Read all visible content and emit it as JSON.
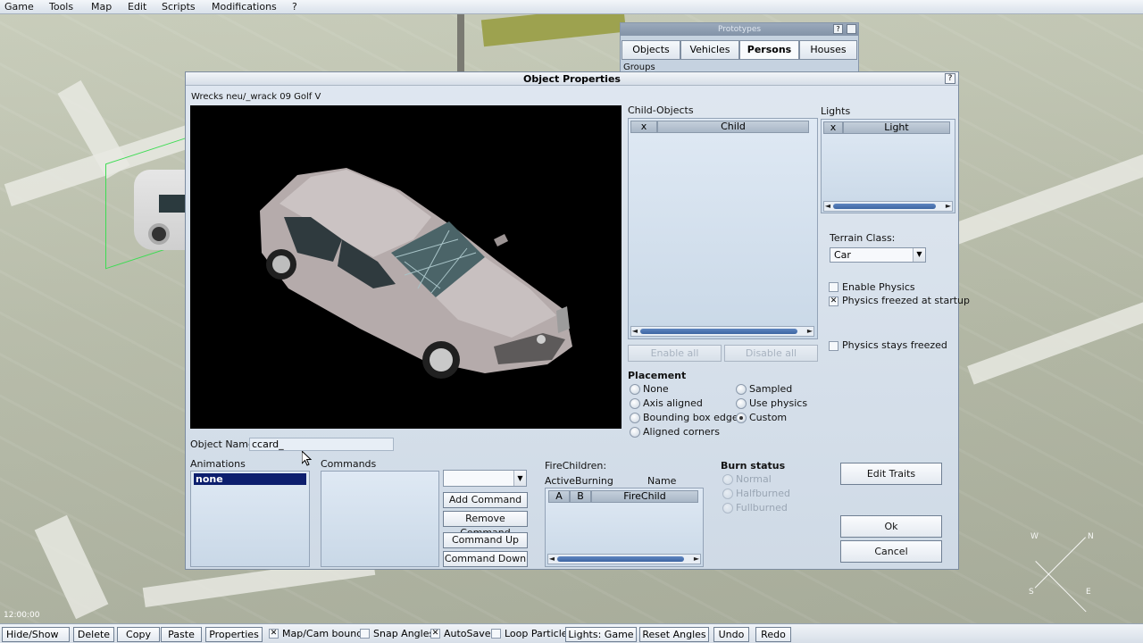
{
  "menu": [
    "Game",
    "Tools",
    "Map",
    "Edit",
    "Scripts",
    "Modifications",
    "?"
  ],
  "prototypes": {
    "title": "Prototypes",
    "help": "?",
    "tabs": [
      "Objects",
      "Vehicles",
      "Persons",
      "Houses"
    ],
    "active_tab": "Persons",
    "groups_label": "Groups"
  },
  "dialog": {
    "title": "Object Properties",
    "help": "?",
    "path": "Wrecks neu/_wrack 09 Golf V",
    "child_objects": {
      "label": "Child-Objects",
      "col_x": "x",
      "col_child": "Child",
      "enable_all": "Enable all",
      "disable_all": "Disable all"
    },
    "lights": {
      "label": "Lights",
      "col_x": "x",
      "col_light": "Light"
    },
    "terrain": {
      "label": "Terrain Class:",
      "value": "Car"
    },
    "physics": {
      "enable": "Enable Physics",
      "freezed_startup": "Physics freezed at startup",
      "stays_freezed": "Physics stays freezed",
      "enable_checked": false,
      "freezed_checked": true,
      "stays_checked": false
    },
    "placement": {
      "label": "Placement",
      "options_left": [
        "None",
        "Axis aligned",
        "Bounding box edges",
        "Aligned corners"
      ],
      "options_right": [
        "Sampled",
        "Use physics",
        "Custom"
      ],
      "selected": "Custom"
    },
    "object_name": {
      "label": "Object Name:",
      "value": "ccard_"
    },
    "animations": {
      "label": "Animations",
      "items": [
        "none"
      ]
    },
    "commands": {
      "label": "Commands",
      "add": "Add Command",
      "remove": "Remove Command",
      "up": "Command Up",
      "down": "Command Down"
    },
    "fire_children": {
      "label": "FireChildren:",
      "col_active": "Active",
      "col_burning": "Burning",
      "col_name": "Name",
      "sub_a": "A",
      "sub_b": "B",
      "sub_name": "FireChild"
    },
    "burn_status": {
      "label": "Burn status",
      "options": [
        "Normal",
        "Halfburned",
        "Fullburned"
      ]
    },
    "edit_traits": "Edit Traits",
    "ok": "Ok",
    "cancel": "Cancel"
  },
  "compass": {
    "w": "W",
    "n": "N",
    "s": "S",
    "e": "E"
  },
  "clock": "12:00:00",
  "toolbar": {
    "hide_show": "Hide/Show",
    "delete": "Delete",
    "copy": "Copy",
    "paste": "Paste",
    "properties": "Properties",
    "map_cam_bounds": "Map/Cam bounds",
    "snap_angles": "Snap Angles",
    "autosave": "AutoSave",
    "loop_particles": "Loop Particles",
    "lights_game": "Lights: Game",
    "reset_angles": "Reset Angles",
    "undo": "Undo",
    "redo": "Redo",
    "map_cam_checked": true,
    "snap_checked": false,
    "autosave_checked": true,
    "loop_checked": false
  }
}
